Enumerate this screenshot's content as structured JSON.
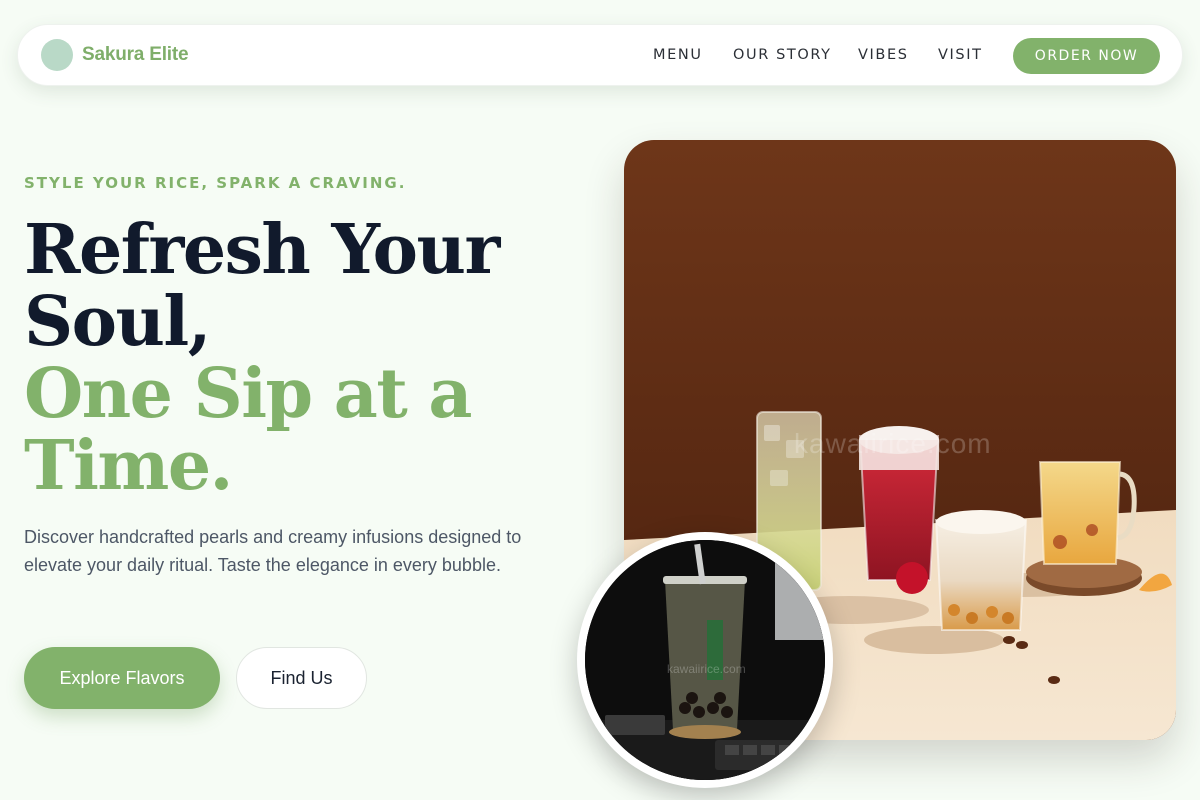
{
  "brand": {
    "name": "Sakura Elite"
  },
  "nav": {
    "links": [
      "MENU",
      "OUR STORY",
      "VIBES",
      "VISIT"
    ],
    "cta": "ORDER NOW"
  },
  "hero": {
    "tagline": "STYLE YOUR RICE, SPARK A CRAVING.",
    "headline_dark": [
      "Refresh Your",
      "Soul,"
    ],
    "headline_accent": [
      "One Sip at a",
      "Time."
    ],
    "description": "Discover handcrafted pearls and creamy infusions designed to elevate your daily ritual. Taste the elegance in every bubble.",
    "primary_button": "Explore Flavors",
    "secondary_button": "Find Us",
    "image_watermark": "kawaiirice.com",
    "circle_watermark": "kawaiirice.com"
  },
  "colors": {
    "accent": "#82b26b",
    "heading": "#111a2c",
    "background": "#f6fcf5"
  }
}
